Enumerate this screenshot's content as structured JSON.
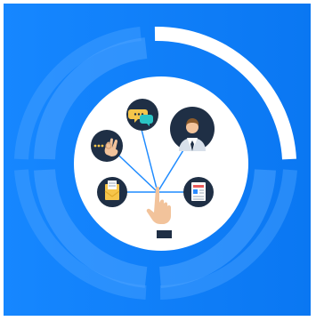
{
  "illustration": {
    "theme_colors": {
      "background": "#0f7ff7",
      "ring_faint": "#4aa2ff",
      "ring_active": "#ffffff",
      "center_circle": "#ffffff",
      "icon_circle": "#1f2f45",
      "connector_line": "#1f8bff",
      "hand_skin": "#f2c39b",
      "shirt_cuff": "#1f2f45"
    },
    "progress_fraction": 0.25,
    "icons": [
      "chat-bubbles-icon",
      "ok-gesture-icon",
      "businessman-icon",
      "mail-envelope-icon",
      "newspaper-icon",
      "pointing-hand-icon"
    ]
  }
}
